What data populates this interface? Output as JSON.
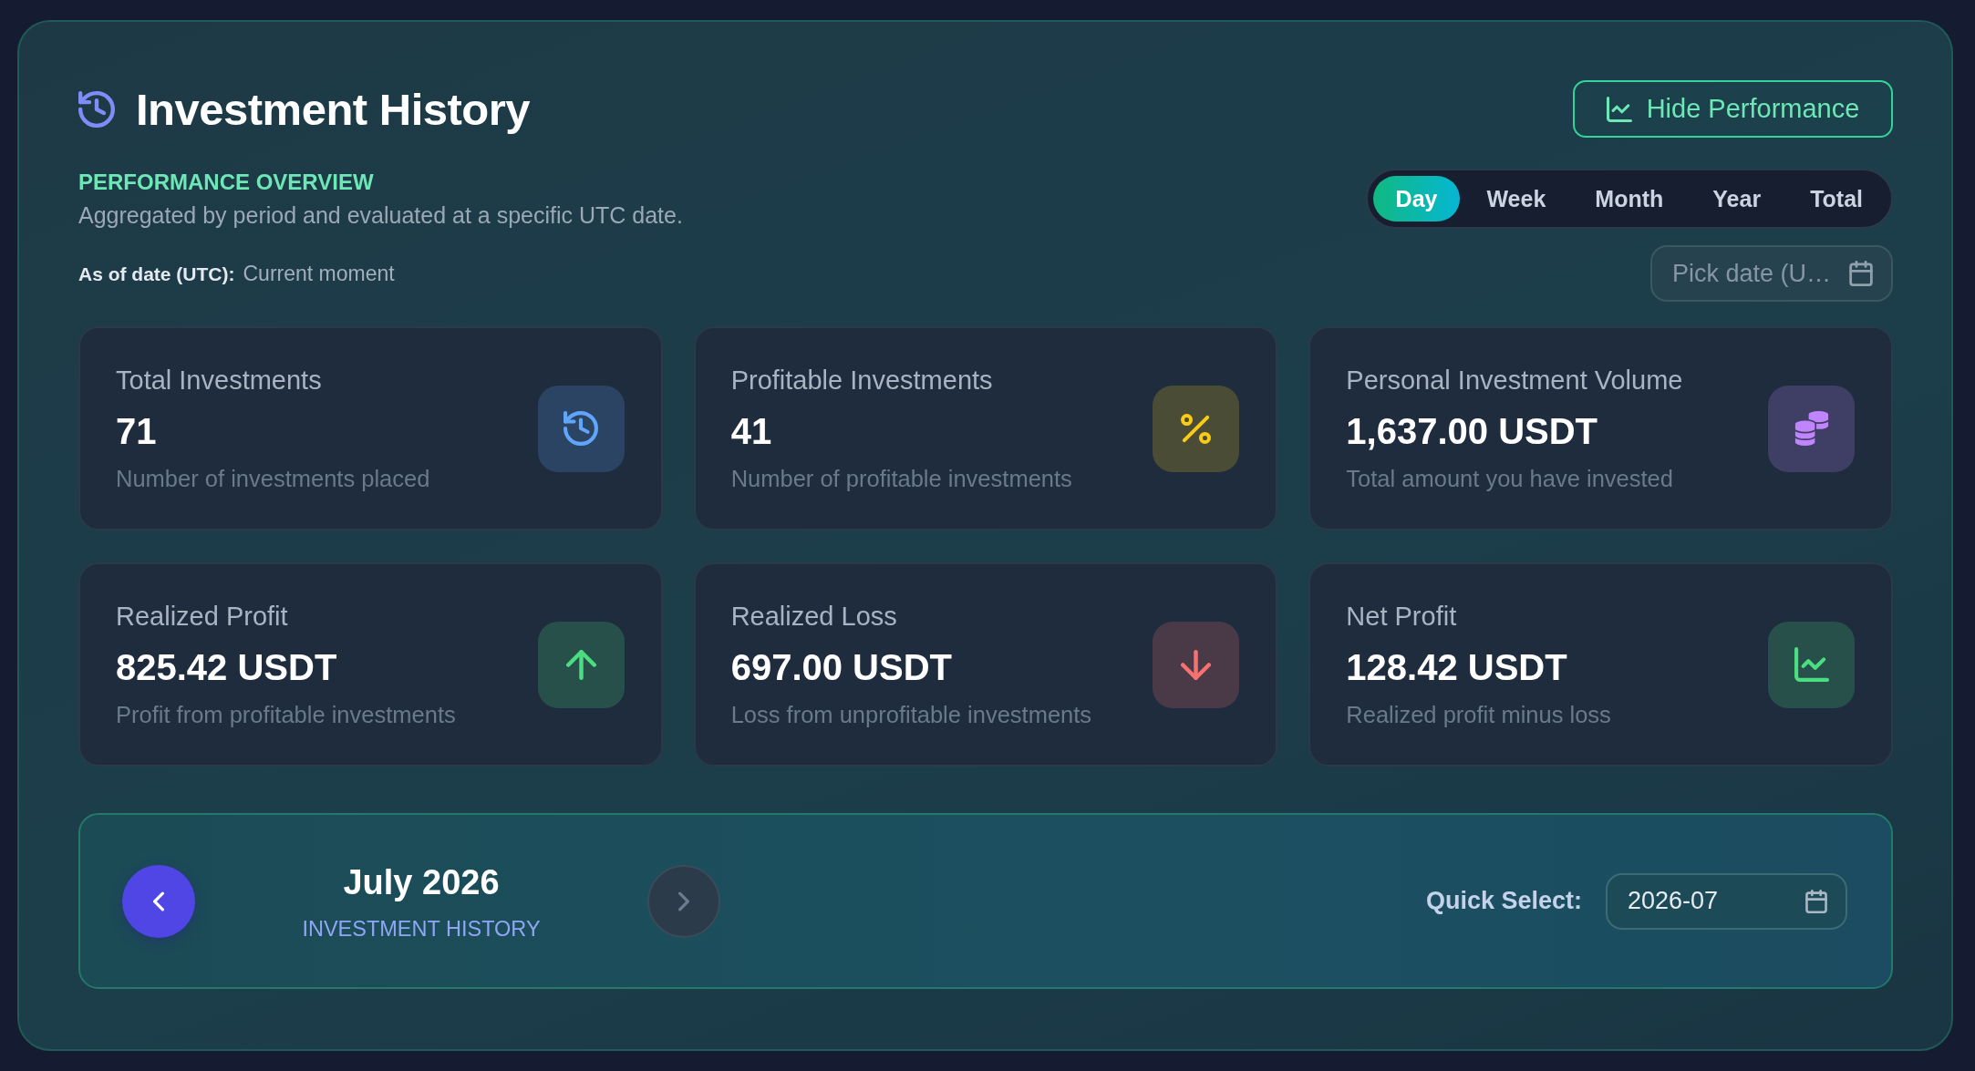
{
  "header": {
    "title": "Investment History",
    "toggle_button": "Hide Performance"
  },
  "overview": {
    "heading": "PERFORMANCE OVERVIEW",
    "description": "Aggregated by period and evaluated at a specific UTC date.",
    "as_of_label": "As of date (UTC):",
    "as_of_value": "Current moment"
  },
  "period_tabs": [
    {
      "label": "Day",
      "selected": true
    },
    {
      "label": "Week",
      "selected": false
    },
    {
      "label": "Month",
      "selected": false
    },
    {
      "label": "Year",
      "selected": false
    },
    {
      "label": "Total",
      "selected": false
    }
  ],
  "date_picker": {
    "placeholder": "Pick date (U…"
  },
  "stats": [
    {
      "kind": "history",
      "color": "#60a5fa",
      "label": "Total Investments",
      "value": "71",
      "description": "Number of investments placed"
    },
    {
      "kind": "percent",
      "color": "#facc15",
      "label": "Profitable Investments",
      "value": "41",
      "description": "Number of profitable investments"
    },
    {
      "kind": "coins",
      "color": "#c084fc",
      "label": "Personal Investment Volume",
      "value": "1,637.00 USDT",
      "description": "Total amount you have invested"
    },
    {
      "kind": "up",
      "color": "#4ade80",
      "label": "Realized Profit",
      "value": "825.42 USDT",
      "description": "Profit from profitable investments"
    },
    {
      "kind": "down",
      "color": "#f87171",
      "label": "Realized Loss",
      "value": "697.00 USDT",
      "description": "Loss from unprofitable investments"
    },
    {
      "kind": "chart",
      "color": "#4ade80",
      "label": "Net Profit",
      "value": "128.42 USDT",
      "description": "Realized profit minus loss"
    }
  ],
  "month_nav": {
    "previous_button": {
      "disabled": false
    },
    "month": "July 2026",
    "caption": "INVESTMENT HISTORY",
    "next_button": {
      "disabled": true
    },
    "quick_select": {
      "label": "Quick Select:",
      "value": "2026-07"
    }
  }
}
